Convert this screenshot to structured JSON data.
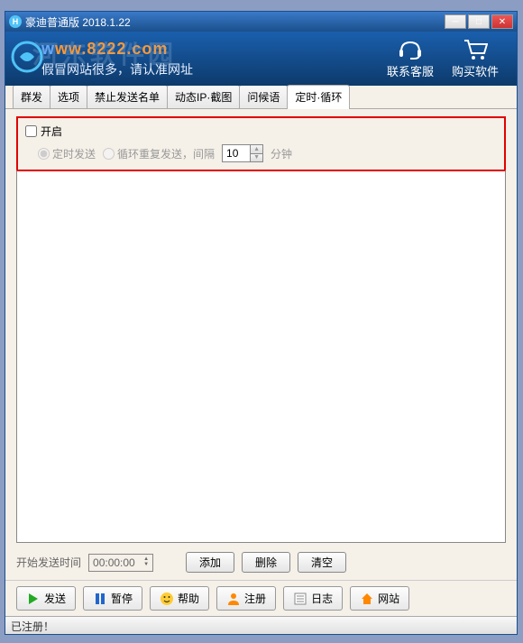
{
  "titlebar": {
    "title": "豪迪普通版 2018.1.22"
  },
  "banner": {
    "url_prefix": "w",
    "url_main": "ww.8222.com",
    "subtitle": "假冒网站很多，请认准网址",
    "watermark": "河东软件园",
    "contact": "联系客服",
    "buy": "购买软件"
  },
  "tabs": [
    "群发",
    "选项",
    "禁止发送名单",
    "动态IP·截图",
    "问候语",
    "定时·循环"
  ],
  "active_tab": 5,
  "panel": {
    "enable_label": "开启",
    "timed_label": "定时发送",
    "loop_label": "循环重复发送，间隔",
    "interval_value": "10",
    "interval_unit": "分钟"
  },
  "bottom": {
    "start_label": "开始发送时间",
    "time_value": "00:00:00",
    "add": "添加",
    "delete": "删除",
    "clear": "清空"
  },
  "toolbar": {
    "send": "发送",
    "pause": "暂停",
    "help": "帮助",
    "register": "注册",
    "log": "日志",
    "website": "网站"
  },
  "status": "已注册！"
}
